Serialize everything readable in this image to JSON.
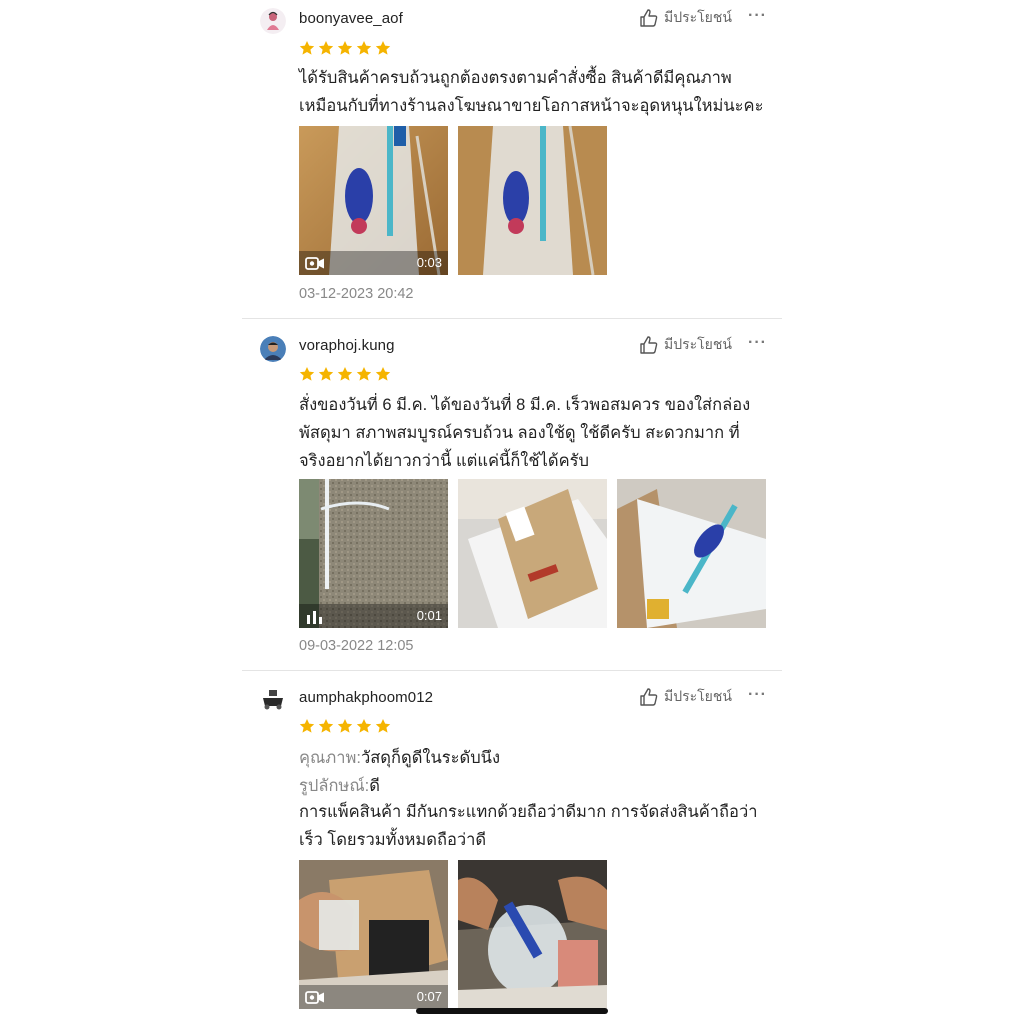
{
  "reviews": [
    {
      "username": "boonyavee_aof",
      "rating": 5,
      "like_label": "มีประโยชน์",
      "more_label": "···",
      "text_lines": [
        "ได้รับสินค้าครบถ้วนถูกต้องตรงตามคำสั่งซื้อ สินค้าดีมีคุณภาพ",
        "เหมือนกับที่ทางร้านลงโฆษณาขายโอกาสหน้าจะอุดหนุนใหม่นะคะ"
      ],
      "media": [
        {
          "kind": "video",
          "duration": "0:03"
        },
        {
          "kind": "photo"
        }
      ],
      "timestamp": "03-12-2023 20:42"
    },
    {
      "username": "voraphoj.kung",
      "rating": 5,
      "like_label": "มีประโยชน์",
      "more_label": "···",
      "text_lines": [
        "สั่งของวันที่ 6 มี.ค. ได้ของวันที่ 8 มี.ค. เร็วพอสมควร ของใส่กล่อง",
        "พัสดุมา สภาพสมบูรณ์ครบถ้วน ลองใช้ดู ใช้ดีครับ สะดวกมาก ที่",
        "จริงอยากได้ยาวกว่านี้ แต่แค่นี้ก็ใช้ได้ครับ"
      ],
      "media": [
        {
          "kind": "video",
          "duration": "0:01"
        },
        {
          "kind": "photo"
        },
        {
          "kind": "photo"
        }
      ],
      "timestamp": "09-03-2022 12:05"
    },
    {
      "username": "aumphakphoom012",
      "rating": 5,
      "like_label": "มีประโยชน์",
      "more_label": "···",
      "attributes": [
        {
          "label": "คุณภาพ:",
          "value": "วัสดุก็ดูดีในระดับนึง"
        },
        {
          "label": "รูปลักษณ์:",
          "value": "ดี"
        }
      ],
      "text_lines": [
        "การแพ็คสินค้า มีกันกระแทกด้วยถือว่าดีมาก การจัดส่งสินค้าถือว่า",
        "เร็ว โดยรวมทั้งหมดถือว่าดี"
      ],
      "media": [
        {
          "kind": "video",
          "duration": "0:07"
        },
        {
          "kind": "photo"
        }
      ],
      "timestamp": ""
    }
  ],
  "colors": {
    "star": "#f5b400",
    "muted_text": "#888888",
    "divider": "#e4e4e4"
  },
  "icons": {
    "like": "thumbs-up-icon",
    "more": "more-options-icon",
    "video": "video-camera-icon",
    "audio": "audio-level-icon",
    "star": "star-icon"
  }
}
